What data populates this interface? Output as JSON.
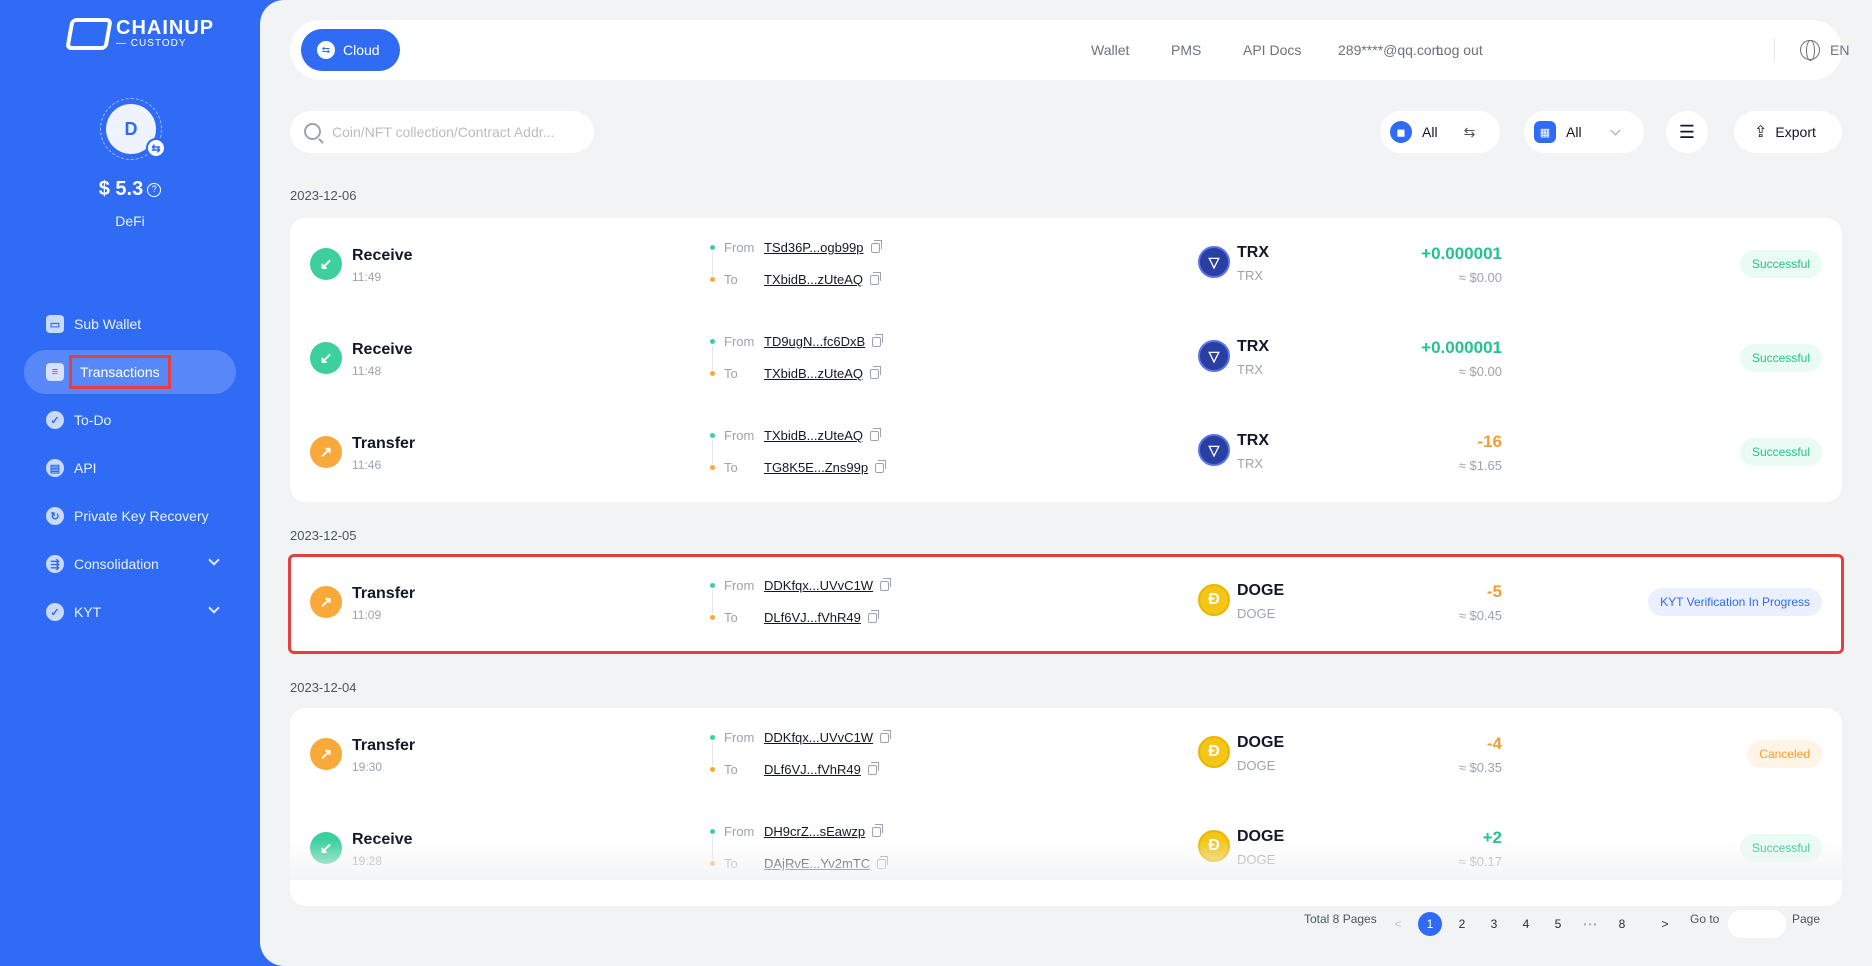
{
  "brand": {
    "name": "CHAINUP",
    "sub": "— CUSTODY"
  },
  "account": {
    "initial": "D",
    "balance": "$ 5.3",
    "type": "DeFi"
  },
  "nav": {
    "items": [
      {
        "label": "Sub Wallet",
        "icon": "wallet-icon"
      },
      {
        "label": "Transactions",
        "icon": "transactions-icon",
        "active": true
      },
      {
        "label": "To-Do",
        "icon": "todo-icon"
      },
      {
        "label": "API",
        "icon": "api-icon"
      },
      {
        "label": "Private Key Recovery",
        "icon": "key-recovery-icon"
      },
      {
        "label": "Consolidation",
        "icon": "consolidation-icon",
        "expandable": true
      },
      {
        "label": "KYT",
        "icon": "kyt-icon",
        "expandable": true
      }
    ]
  },
  "topbar": {
    "cloud": "Cloud",
    "wallet": "Wallet",
    "pms": "PMS",
    "api_docs": "API Docs",
    "email": "289****@qq.com",
    "logout": "Log out",
    "lang": "EN"
  },
  "search": {
    "placeholder": "Coin/NFT collection/Contract Addr..."
  },
  "filters": {
    "direction": "All",
    "type": "All",
    "export": "Export"
  },
  "groups": [
    {
      "date": "2023-12-06",
      "items": [
        {
          "type": "Receive",
          "dir": "in",
          "time": "11:49",
          "from": "TSd36P...ogb99p",
          "to": "TXbidB...zUteAQ",
          "symbol": "TRX",
          "coin": "TRX",
          "amount": "+0.000001",
          "fiat": "≈ $0.00",
          "status": "Successful"
        },
        {
          "type": "Receive",
          "dir": "in",
          "time": "11:48",
          "from": "TD9ugN...fc6DxB",
          "to": "TXbidB...zUteAQ",
          "symbol": "TRX",
          "coin": "TRX",
          "amount": "+0.000001",
          "fiat": "≈ $0.00",
          "status": "Successful"
        },
        {
          "type": "Transfer",
          "dir": "out",
          "time": "11:46",
          "from": "TXbidB...zUteAQ",
          "to": "TG8K5E...Zns99p",
          "symbol": "TRX",
          "coin": "TRX",
          "amount": "-16",
          "fiat": "≈ $1.65",
          "status": "Successful"
        }
      ]
    },
    {
      "date": "2023-12-05",
      "items": [
        {
          "type": "Transfer",
          "dir": "out",
          "time": "11:09",
          "from": "DDKfqx...UVvC1W",
          "to": "DLf6VJ...fVhR49",
          "symbol": "DOGE",
          "coin": "DOGE",
          "amount": "-5",
          "fiat": "≈ $0.45",
          "status": "KYT Verification In Progress"
        }
      ]
    },
    {
      "date": "2023-12-04",
      "items": [
        {
          "type": "Transfer",
          "dir": "out",
          "time": "19:30",
          "from": "DDKfqx...UVvC1W",
          "to": "DLf6VJ...fVhR49",
          "symbol": "DOGE",
          "coin": "DOGE",
          "amount": "-4",
          "fiat": "≈ $0.35",
          "status": "Canceled"
        },
        {
          "type": "Receive",
          "dir": "in",
          "time": "19:28",
          "from": "DH9crZ...sEawzp",
          "to": "DAjRvE...Yv2mTC",
          "symbol": "DOGE",
          "coin": "DOGE",
          "amount": "+2",
          "fiat": "≈ $0.17",
          "status": "Successful"
        }
      ]
    }
  ],
  "labels": {
    "from": "From",
    "to": "To"
  },
  "pagination": {
    "total": "Total 8 Pages",
    "pages": [
      "1",
      "2",
      "3",
      "4",
      "5",
      "• • •",
      "8"
    ],
    "prev": "<",
    "next": ">",
    "goto": "Go to",
    "page_suffix": "Page"
  }
}
